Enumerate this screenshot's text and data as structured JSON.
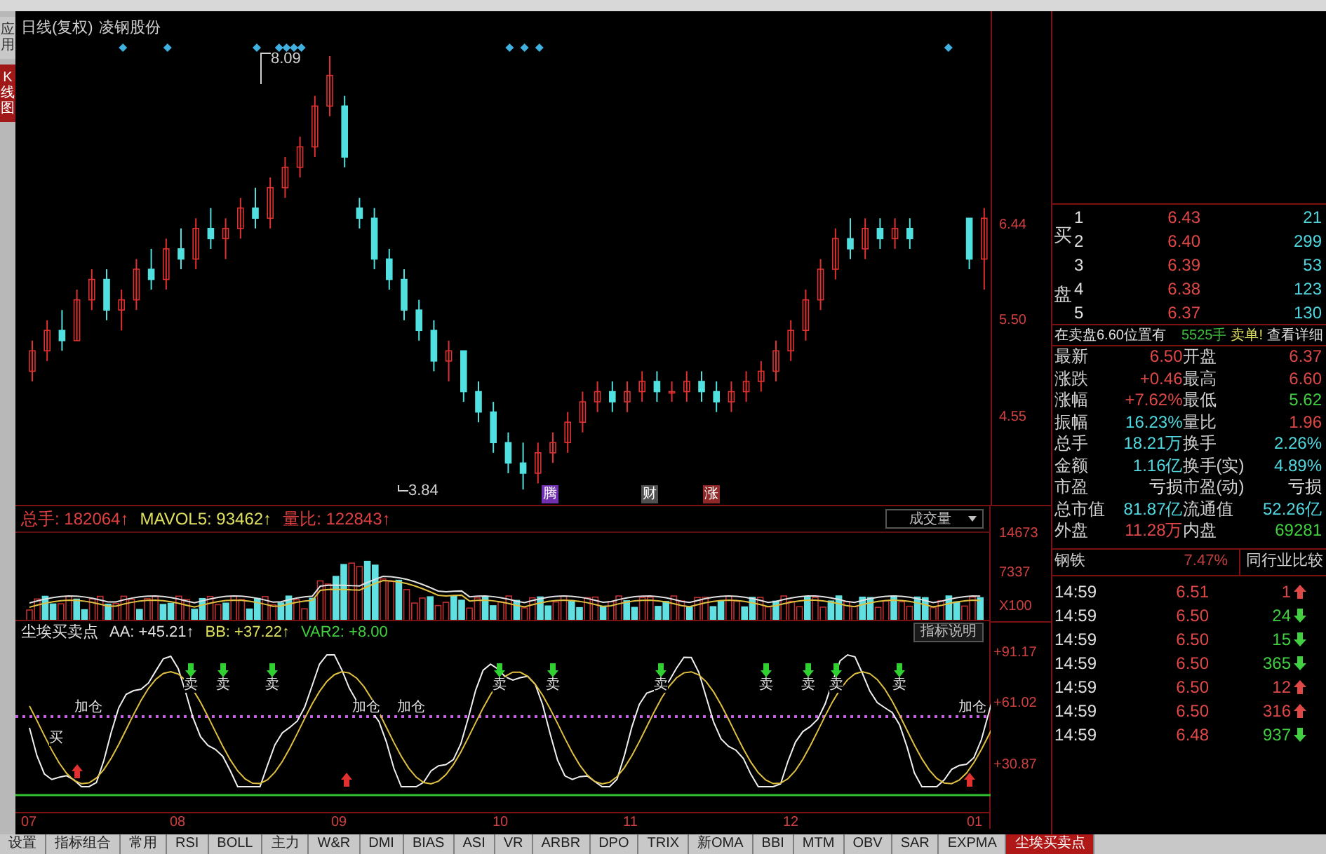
{
  "left_tabs": [
    {
      "label": "应用",
      "selected": false
    },
    {
      "label": "K线图",
      "selected": true
    }
  ],
  "kline": {
    "title": "日线(复权)",
    "stock": "凌钢股份",
    "high_label": "8.09",
    "low_label": "3.84",
    "chart_data": {
      "type": "candlestick",
      "ylim": [
        3.69,
        8.53
      ],
      "yticks": [
        {
          "value": 6.44,
          "label": "6.44"
        },
        {
          "value": 5.5,
          "label": "5.50"
        },
        {
          "value": 4.55,
          "label": "4.55"
        }
      ],
      "ohlc": [
        [
          5.0,
          5.3,
          4.9,
          5.2
        ],
        [
          5.2,
          5.5,
          5.1,
          5.4
        ],
        [
          5.4,
          5.6,
          5.2,
          5.3
        ],
        [
          5.3,
          5.8,
          5.3,
          5.7
        ],
        [
          5.7,
          6.0,
          5.6,
          5.9
        ],
        [
          5.9,
          6.0,
          5.5,
          5.6
        ],
        [
          5.6,
          5.8,
          5.4,
          5.7
        ],
        [
          5.7,
          6.1,
          5.6,
          6.0
        ],
        [
          6.0,
          6.2,
          5.8,
          5.9
        ],
        [
          5.9,
          6.3,
          5.8,
          6.2
        ],
        [
          6.2,
          6.4,
          6.0,
          6.1
        ],
        [
          6.1,
          6.5,
          6.0,
          6.4
        ],
        [
          6.4,
          6.6,
          6.2,
          6.3
        ],
        [
          6.3,
          6.5,
          6.1,
          6.4
        ],
        [
          6.4,
          6.7,
          6.3,
          6.6
        ],
        [
          6.6,
          6.8,
          6.4,
          6.5
        ],
        [
          6.5,
          6.9,
          6.4,
          6.8
        ],
        [
          6.8,
          7.1,
          6.7,
          7.0
        ],
        [
          7.0,
          7.3,
          6.9,
          7.2
        ],
        [
          7.2,
          7.7,
          7.1,
          7.6
        ],
        [
          7.6,
          8.09,
          7.5,
          7.9
        ],
        [
          7.6,
          7.7,
          7.0,
          7.1
        ],
        [
          6.6,
          6.7,
          6.4,
          6.5
        ],
        [
          6.5,
          6.6,
          6.0,
          6.1
        ],
        [
          6.1,
          6.2,
          5.8,
          5.9
        ],
        [
          5.9,
          6.0,
          5.5,
          5.6
        ],
        [
          5.6,
          5.7,
          5.3,
          5.4
        ],
        [
          5.4,
          5.5,
          5.0,
          5.1
        ],
        [
          5.1,
          5.3,
          4.9,
          5.2
        ],
        [
          5.2,
          5.2,
          4.7,
          4.8
        ],
        [
          4.8,
          4.9,
          4.5,
          4.6
        ],
        [
          4.6,
          4.7,
          4.2,
          4.3
        ],
        [
          4.3,
          4.4,
          4.0,
          4.1
        ],
        [
          4.1,
          4.3,
          3.84,
          4.0
        ],
        [
          4.0,
          4.3,
          3.9,
          4.2
        ],
        [
          4.2,
          4.4,
          4.1,
          4.3
        ],
        [
          4.3,
          4.6,
          4.2,
          4.5
        ],
        [
          4.5,
          4.8,
          4.4,
          4.7
        ],
        [
          4.7,
          4.9,
          4.6,
          4.8
        ],
        [
          4.8,
          4.9,
          4.6,
          4.7
        ],
        [
          4.7,
          4.9,
          4.6,
          4.8
        ],
        [
          4.8,
          5.0,
          4.7,
          4.9
        ],
        [
          4.9,
          5.0,
          4.7,
          4.8
        ],
        [
          4.8,
          4.9,
          4.7,
          4.8
        ],
        [
          4.8,
          5.0,
          4.7,
          4.9
        ],
        [
          4.9,
          5.0,
          4.7,
          4.8
        ],
        [
          4.8,
          4.9,
          4.6,
          4.7
        ],
        [
          4.7,
          4.9,
          4.6,
          4.8
        ],
        [
          4.8,
          5.0,
          4.7,
          4.9
        ],
        [
          4.9,
          5.1,
          4.8,
          5.0
        ],
        [
          5.0,
          5.3,
          4.9,
          5.2
        ],
        [
          5.2,
          5.5,
          5.1,
          5.4
        ],
        [
          5.4,
          5.8,
          5.3,
          5.7
        ],
        [
          5.7,
          6.1,
          5.6,
          6.0
        ],
        [
          6.0,
          6.4,
          5.9,
          6.3
        ],
        [
          6.3,
          6.5,
          6.1,
          6.2
        ],
        [
          6.2,
          6.5,
          6.1,
          6.4
        ],
        [
          6.4,
          6.5,
          6.2,
          6.3
        ],
        [
          6.3,
          6.5,
          6.2,
          6.4
        ],
        [
          6.4,
          6.5,
          6.2,
          6.3
        ],
        null,
        null,
        null,
        [
          6.5,
          6.5,
          6.0,
          6.1
        ],
        [
          6.1,
          6.6,
          5.8,
          6.5
        ]
      ]
    },
    "event_tags": [
      {
        "label": "腾",
        "color": "#7030b0"
      },
      {
        "label": "财",
        "color": "#505050"
      },
      {
        "label": "涨",
        "color": "#902828"
      }
    ]
  },
  "volume": {
    "stats": [
      {
        "label": "总手:",
        "value": "182064↑",
        "color": "#e04040"
      },
      {
        "label": "MAVOL5:",
        "value": "93462↑",
        "color": "#e0e060"
      },
      {
        "label": "量比:",
        "value": "122843↑",
        "color": "#e04040"
      }
    ],
    "dropdown": "成交量",
    "axis": [
      "14673",
      "7337",
      "X100"
    ]
  },
  "indicator": {
    "name": "尘埃买卖点",
    "stats": [
      {
        "label": "AA:",
        "value": "+45.21↑",
        "color": "#e0e0e0"
      },
      {
        "label": "BB:",
        "value": "+37.22↑",
        "color": "#e0e060"
      },
      {
        "label": "VAR2:",
        "value": "+8.00",
        "color": "#40d040"
      }
    ],
    "button": "指标说明",
    "axis": [
      "+91.17",
      "+61.02",
      "+30.87"
    ],
    "signals": [
      {
        "label": "买",
        "kind": "buy"
      },
      {
        "label": "加仓",
        "kind": "add"
      },
      {
        "label": "卖",
        "kind": "sell"
      },
      {
        "label": "卖",
        "kind": "sell"
      },
      {
        "label": "卖",
        "kind": "sell"
      },
      {
        "label": "加仓",
        "kind": "add"
      },
      {
        "label": "加仓",
        "kind": "add"
      },
      {
        "label": "卖",
        "kind": "sell"
      },
      {
        "label": "卖",
        "kind": "sell"
      },
      {
        "label": "卖",
        "kind": "sell"
      },
      {
        "label": "卖",
        "kind": "sell"
      },
      {
        "label": "卖",
        "kind": "sell"
      },
      {
        "label": "卖",
        "kind": "sell"
      },
      {
        "label": "卖",
        "kind": "sell"
      },
      {
        "label": "加仓",
        "kind": "add"
      }
    ]
  },
  "months": [
    "07",
    "08",
    "09",
    "10",
    "11",
    "12",
    "01"
  ],
  "bottom_tabs": [
    {
      "label": "设置",
      "selected": false
    },
    {
      "label": "指标组合",
      "selected": false
    },
    {
      "label": "常用",
      "selected": false
    },
    {
      "label": "RSI",
      "selected": false
    },
    {
      "label": "BOLL",
      "selected": false
    },
    {
      "label": "主力",
      "selected": false
    },
    {
      "label": "W&R",
      "selected": false
    },
    {
      "label": "DMI",
      "selected": false
    },
    {
      "label": "BIAS",
      "selected": false
    },
    {
      "label": "ASI",
      "selected": false
    },
    {
      "label": "VR",
      "selected": false
    },
    {
      "label": "ARBR",
      "selected": false
    },
    {
      "label": "DPO",
      "selected": false
    },
    {
      "label": "TRIX",
      "selected": false
    },
    {
      "label": "新OMA",
      "selected": false
    },
    {
      "label": "BBI",
      "selected": false
    },
    {
      "label": "MTM",
      "selected": false
    },
    {
      "label": "OBV",
      "selected": false
    },
    {
      "label": "SAR",
      "selected": false
    },
    {
      "label": "EXPMA",
      "selected": false
    },
    {
      "label": "尘埃买卖点",
      "selected": true
    }
  ],
  "order_book": {
    "side_label": [
      "买",
      "盘"
    ],
    "rows": [
      {
        "level": "1",
        "price": "6.43",
        "volume": "21"
      },
      {
        "level": "2",
        "price": "6.40",
        "volume": "299"
      },
      {
        "level": "3",
        "price": "6.39",
        "volume": "53"
      },
      {
        "level": "4",
        "price": "6.38",
        "volume": "123"
      },
      {
        "level": "5",
        "price": "6.37",
        "volume": "130"
      }
    ]
  },
  "notice": {
    "text": "在卖盘6.60位置有",
    "volume": "5525手",
    "tail": "卖单!",
    "link": "查看详细"
  },
  "quote": [
    {
      "label": "最新",
      "value": "6.50",
      "color": "#e04848"
    },
    {
      "label": "开盘",
      "value": "6.37",
      "color": "#e04848"
    },
    {
      "label": "涨跌",
      "value": "+0.46",
      "color": "#e04848"
    },
    {
      "label": "最高",
      "value": "6.60",
      "color": "#e04848"
    },
    {
      "label": "涨幅",
      "value": "+7.62%",
      "color": "#e04848"
    },
    {
      "label": "最低",
      "value": "5.62",
      "color": "#40d040"
    },
    {
      "label": "振幅",
      "value": "16.23%",
      "color": "#50d8e0"
    },
    {
      "label": "量比",
      "value": "1.96",
      "color": "#e04848"
    },
    {
      "label": "总手",
      "value": "18.21万",
      "color": "#50d8e0"
    },
    {
      "label": "换手",
      "value": "2.26%",
      "color": "#50d8e0"
    },
    {
      "label": "金额",
      "value": "1.16亿",
      "color": "#50d8e0"
    },
    {
      "label": "换手(实)",
      "value": "4.89%",
      "color": "#50d8e0"
    },
    {
      "label": "市盈",
      "value": "亏损",
      "color": "#e0e0e0"
    },
    {
      "label": "市盈(动)",
      "value": "亏损",
      "color": "#e0e0e0"
    },
    {
      "label": "总市值",
      "value": "81.87亿",
      "color": "#50d8e0"
    },
    {
      "label": "流通值",
      "value": "52.26亿",
      "color": "#50d8e0"
    },
    {
      "label": "外盘",
      "value": "11.28万",
      "color": "#e04848"
    },
    {
      "label": "内盘",
      "value": "69281",
      "color": "#40d040"
    }
  ],
  "industry": {
    "name": "钢铁",
    "change": "7.47%",
    "button": "同行业比较"
  },
  "ticks": [
    {
      "time": "14:59",
      "price": "6.51",
      "volume": "1",
      "kind": "up"
    },
    {
      "time": "14:59",
      "price": "6.50",
      "volume": "24",
      "kind": "down"
    },
    {
      "time": "14:59",
      "price": "6.50",
      "volume": "15",
      "kind": "down"
    },
    {
      "time": "14:59",
      "price": "6.50",
      "volume": "365",
      "kind": "down"
    },
    {
      "time": "14:59",
      "price": "6.50",
      "volume": "12",
      "kind": "up"
    },
    {
      "time": "14:59",
      "price": "6.50",
      "volume": "316",
      "kind": "up"
    },
    {
      "time": "14:59",
      "price": "6.48",
      "volume": "937",
      "kind": "down"
    }
  ]
}
